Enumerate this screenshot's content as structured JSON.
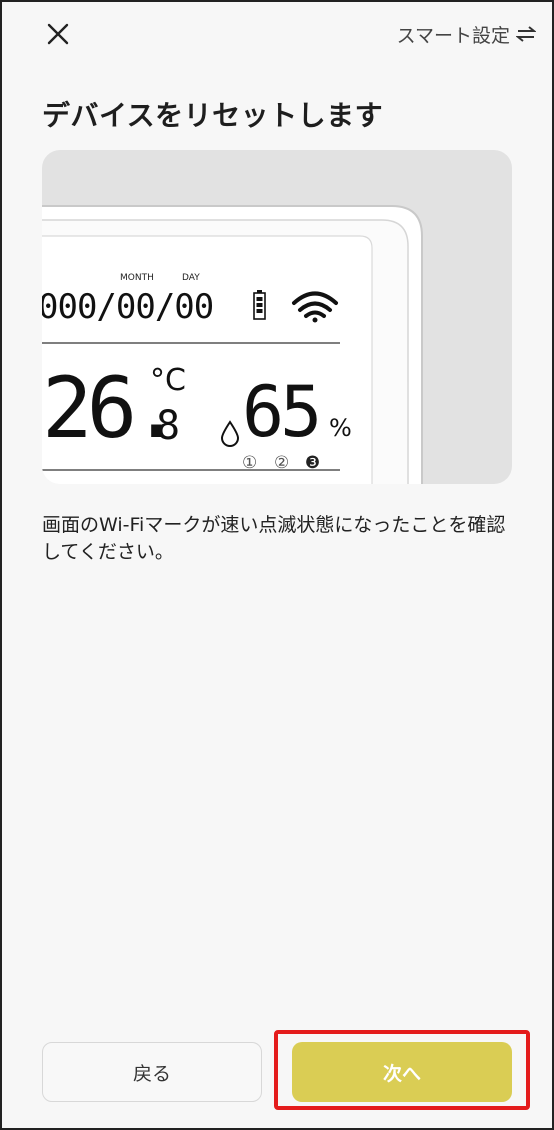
{
  "header": {
    "close_icon": "close-icon",
    "smart_setting_label": "スマート設定",
    "switch_icon": "swap-arrows-icon"
  },
  "page": {
    "title": "デバイスをリセットします",
    "instruction": "画面のWi-Fiマークが速い点滅状態になったことを確認してください。"
  },
  "device_display": {
    "month_label": "MONTH",
    "day_label": "DAY",
    "date_digits": "000/00/00",
    "temperature_main": "26.",
    "temperature_decimal": "8",
    "temperature_unit": "°C",
    "humidity_value": "65",
    "humidity_unit": "%",
    "indicator_1": "①",
    "indicator_2": "②",
    "indicator_3": "❸"
  },
  "footer": {
    "back_label": "戻る",
    "next_label": "次へ",
    "next_color": "#dacd54",
    "highlight_color": "#e41c1c"
  }
}
